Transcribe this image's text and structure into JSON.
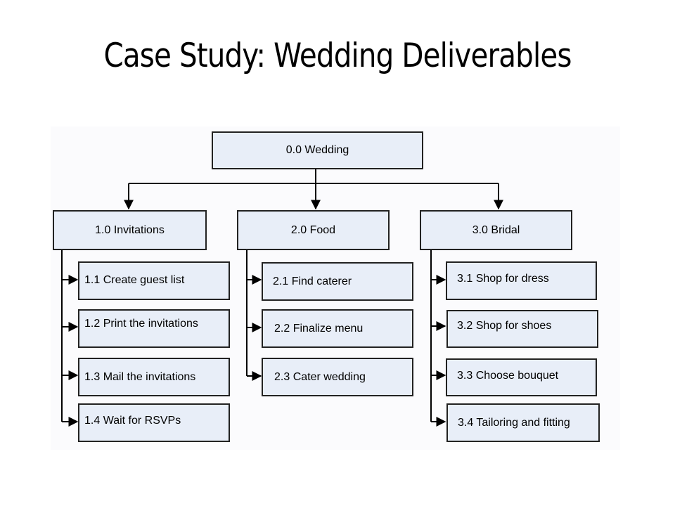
{
  "title": "Case Study: Wedding Deliverables",
  "colors": {
    "box_fill": "#e8eef8",
    "box_border": "#222222",
    "connector": "#000000"
  },
  "diagram": {
    "root": {
      "label": "0.0 Wedding"
    },
    "branches": [
      {
        "label": "1.0 Invitations",
        "children": [
          {
            "label": "1.1 Create guest list"
          },
          {
            "label": "1.2 Print the invitations"
          },
          {
            "label": "1.3 Mail the invitations"
          },
          {
            "label": "1.4 Wait for RSVPs"
          }
        ]
      },
      {
        "label": "2.0 Food",
        "children": [
          {
            "label": "2.1 Find caterer"
          },
          {
            "label": "2.2 Finalize menu"
          },
          {
            "label": "2.3 Cater wedding"
          }
        ]
      },
      {
        "label": "3.0 Bridal",
        "children": [
          {
            "label": "3.1 Shop for dress"
          },
          {
            "label": "3.2 Shop for shoes"
          },
          {
            "label": "3.3 Choose bouquet"
          },
          {
            "label": "3.4 Tailoring and fitting"
          }
        ]
      }
    ]
  }
}
